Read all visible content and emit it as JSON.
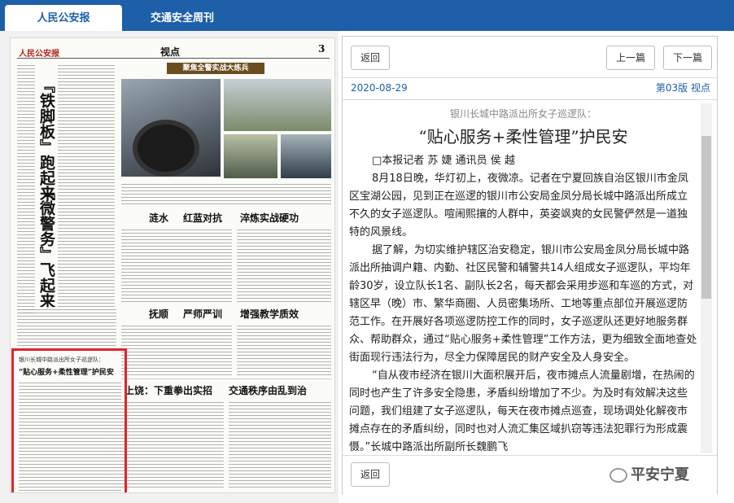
{
  "tabs": [
    {
      "label": "人民公安报"
    },
    {
      "label": "交通安全周刊"
    }
  ],
  "newspaper": {
    "masthead": "人民公安报",
    "section": "视点",
    "page_number": "3",
    "banner": "聚焦全警实战大练兵",
    "side_headline_1": "『铁脚板』跑起来",
    "side_headline_2": "『微警务』飞起来",
    "headline_row_1": [
      "涟水",
      "红蓝对抗",
      "淬炼实战硬功"
    ],
    "headline_row_2": [
      "抚顺",
      "严师严训",
      "增强教学质效"
    ],
    "headline_row_3": [
      "上饶：下重拳出实招",
      "交通秩序由乱到治"
    ],
    "box_kicker": "银川长城中路派出所女子巡逻队：",
    "box_headline": "“贴心服务+柔性管理”护民安"
  },
  "nav": {
    "back_label": "返回",
    "prev_label": "上一篇",
    "next_label": "下一篇",
    "date": "2020-08-29",
    "page_info": "第03版 视点",
    "bottom_back_label": "返回",
    "watermark": "平安宁夏"
  },
  "article": {
    "kicker": "银川长城中路派出所女子巡逻队：",
    "title": "“贴心服务+柔性管理”护民安",
    "byline": "□本报记者 苏 婕 通讯员 侯 越",
    "paragraphs": [
      "8月18日晚，华灯初上，夜微凉。记者在宁夏回族自治区银川市金凤区宝湖公园，见到正在巡逻的银川市公安局金凤分局长城中路派出所成立不久的女子巡逻队。喧闹熙攘的人群中，英姿飒爽的女民警俨然是一道独特的风景线。",
      "据了解，为切实维护辖区治安稳定，银川市公安局金凤分局长城中路派出所抽调户籍、内勤、社区民警和辅警共14人组成女子巡逻队，平均年龄30岁，设立队长1名、副队长2名，每天都会采用步巡和车巡的方式，对辖区早（晚）市、繁华商圈、人员密集场所、工地等重点部位开展巡逻防范工作。在开展好各项巡逻防控工作的同时，女子巡逻队还更好地服务群众、帮助群众，通过“贴心服务+柔性管理”工作方法，更为细致全面地查处街面现行违法行为，尽全力保障居民的财产安全及人身安全。",
      "“自从夜市经济在银川大面积展开后，夜市摊点人流量剧增，在热闹的同时也产生了许多安全隐患，矛盾纠纷增加了不少。为及时有效解决这些问题，我们组建了女子巡逻队，每天在夜市摊点巡查，现场调处化解夜市摊点存在的矛盾纠纷，同时也对人流汇集区域扒窃等违法犯罪行为形成震慑。”长城中路派出所副所长魏鹏飞"
    ]
  },
  "colors": {
    "brand_blue": "#1d5fa8",
    "highlight_red": "#e3222a",
    "kicker_gray": "#888888"
  }
}
